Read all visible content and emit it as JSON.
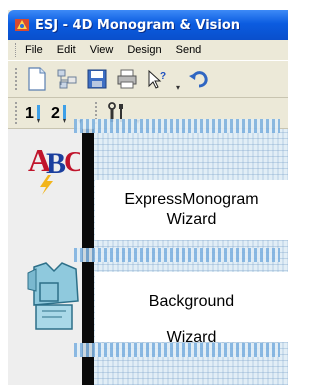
{
  "window": {
    "title": "ESJ - 4D Monogram & Vision",
    "icon": "app-logo-icon"
  },
  "menu": {
    "items": [
      {
        "label": "File"
      },
      {
        "label": "Edit"
      },
      {
        "label": "View"
      },
      {
        "label": "Design"
      },
      {
        "label": "Send"
      }
    ]
  },
  "toolbar": {
    "buttons": [
      "new-file-icon",
      "document-tree-icon",
      "save-icon",
      "print-icon",
      "help-pointer-icon",
      "undo-icon"
    ]
  },
  "toolbar2": {
    "step1": "1",
    "step2": "2",
    "buttons": [
      "step-1-icon",
      "step-2-icon",
      "tools-icon"
    ]
  },
  "left_panel": {
    "buttons": [
      "monogram-abc-icon",
      "shirt-design-icon"
    ]
  },
  "tooltips": {
    "express_monogram": "ExpressMonogram Wizard",
    "background": "Background Wizard"
  },
  "colors": {
    "titlebar": "#0A4FCC",
    "chrome": "#ECE9D8",
    "canvas": "#E2EEF6"
  }
}
